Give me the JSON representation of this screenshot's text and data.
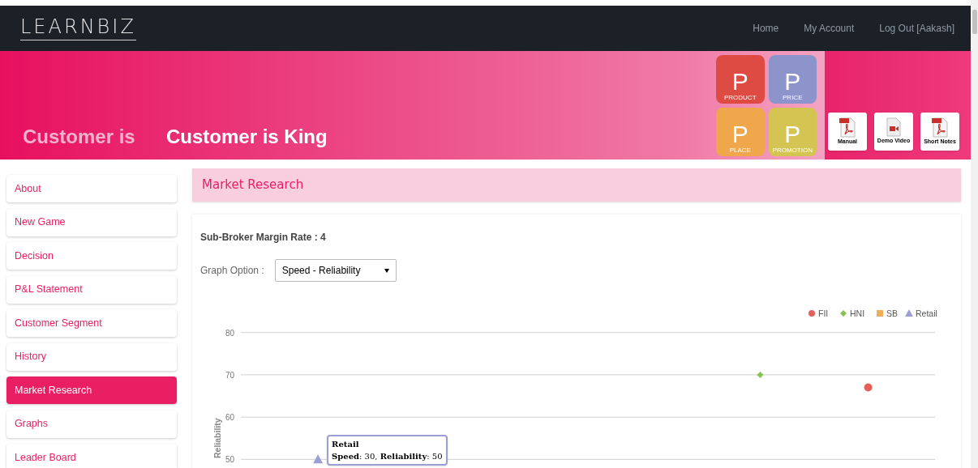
{
  "nav": {
    "logo": "LEARNBIZ",
    "links": [
      "Home",
      "My Account",
      "Log Out [Aakash]"
    ]
  },
  "banner": {
    "blurred_title": "Customer is",
    "title": "Customer is King",
    "tiles": [
      {
        "letter": "P",
        "label": "PRODUCT",
        "color": "#de4b43"
      },
      {
        "letter": "P",
        "label": "PRICE",
        "color": "#8d93cb"
      },
      {
        "letter": "P",
        "label": "PLACE",
        "color": "#f0a64a"
      },
      {
        "letter": "P",
        "label": "PROMOTION",
        "color": "#d4c452"
      }
    ],
    "documents": [
      {
        "kind": "pdf",
        "label": "Manual"
      },
      {
        "kind": "video",
        "label": "Demo Video"
      },
      {
        "kind": "pdf",
        "label": "Short Notes"
      }
    ]
  },
  "sidebar": {
    "items": [
      {
        "label": "About",
        "selected": false
      },
      {
        "label": "New Game",
        "selected": false
      },
      {
        "label": "Decision",
        "selected": false
      },
      {
        "label": "P&L Statement",
        "selected": false
      },
      {
        "label": "Customer Segment",
        "selected": false
      },
      {
        "label": "History",
        "selected": false
      },
      {
        "label": "Market Research",
        "selected": true
      },
      {
        "label": "Graphs",
        "selected": false
      },
      {
        "label": "Leader Board",
        "selected": false
      }
    ]
  },
  "main": {
    "heading": "Market Research",
    "margin_rate": "Sub-Broker Margin Rate : 4",
    "graph_option": {
      "label": "Graph Option :",
      "value": "Speed - Reliability"
    },
    "chart": {
      "ylabel": "Reliability",
      "yticks": [
        "80",
        "70",
        "60",
        "50"
      ],
      "legend": [
        {
          "name": "FII",
          "color": "#e5605a",
          "kind": "circle"
        },
        {
          "name": "HNI",
          "color": "#8cc152",
          "kind": "diamond"
        },
        {
          "name": "SB",
          "color": "#f0ad5a",
          "kind": "square"
        },
        {
          "name": "Retail",
          "color": "#9b9fd6",
          "kind": "triangle"
        }
      ]
    },
    "tooltip": {
      "title": "Retail",
      "text": "**Speed**: 30,  **Reliability**: 50"
    }
  }
}
